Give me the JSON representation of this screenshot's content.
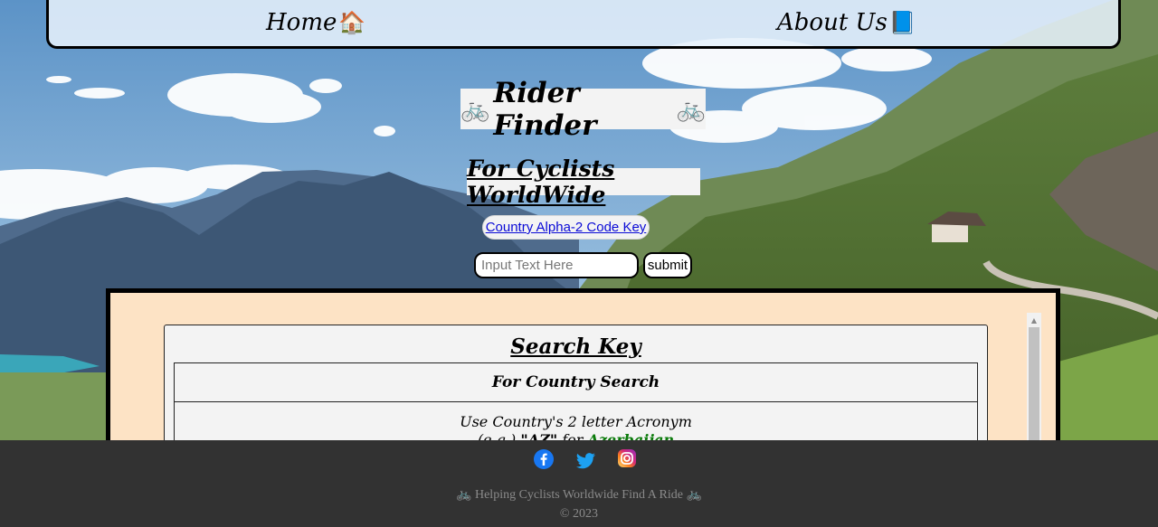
{
  "nav": {
    "home_label": "Home",
    "home_icon": "🏠",
    "about_label": "About Us",
    "about_icon": "📘"
  },
  "header": {
    "title": "Rider Finder",
    "bike_icon": "🚲",
    "subtitle": "For Cyclists WorldWide"
  },
  "search": {
    "key_link_label": "Country Alpha-2 Code Key",
    "placeholder": "Input Text Here",
    "value": "",
    "submit_label": "submit"
  },
  "key_card": {
    "heading": "Search Key",
    "table_header": "For Country Search",
    "instruction": "Use Country's 2 letter Acronym",
    "example_prefix": "(e.g.)",
    "example_code": "\"AZ\"",
    "example_for": "for",
    "example_country": "Azerbaijan"
  },
  "footer": {
    "social_icons": [
      "facebook-icon",
      "twitter-icon",
      "instagram-icon"
    ],
    "tagline": "Helping Cyclists Worldwide Find A Ride",
    "tagline_icon": "🚲",
    "copyright": "© 2023"
  },
  "colors": {
    "panel_bg": "#fde3c5",
    "footer_bg": "#323232",
    "link": "#0a0ad6",
    "country_green": "#0a7a0a",
    "facebook": "#1877f2",
    "twitter": "#1da1f2"
  }
}
